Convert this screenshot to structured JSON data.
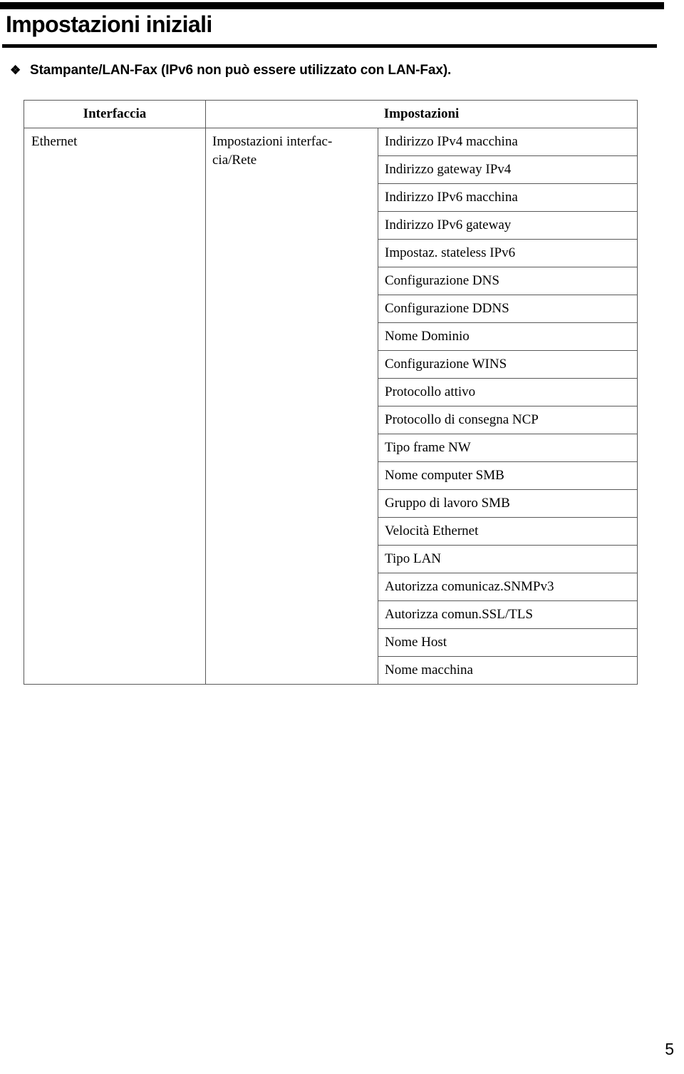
{
  "page": {
    "chapter_title": "Impostazioni iniziali",
    "folio": "5"
  },
  "caption": {
    "bullet_icon": "diamond-bullet-icon",
    "bullet_glyph": "❖",
    "text": "Stampante/LAN-Fax (IPv6 non può essere utilizzato con LAN-Fax)."
  },
  "table": {
    "headers": {
      "interface": "Interfaccia",
      "settings": "Impostazioni"
    },
    "rows": [
      {
        "interface": "Ethernet",
        "group": "Impostazioni interfac-­cia/Rete",
        "group_line1": "Impostazioni interfac-",
        "group_line2": "cia/Rete",
        "details": [
          "Indirizzo IPv4 macchina",
          "Indirizzo gateway IPv4",
          "Indirizzo IPv6 macchina",
          "Indirizzo IPv6 gateway",
          "Impostaz. stateless IPv6",
          "Configurazione DNS",
          "Configurazione DDNS",
          "Nome Dominio",
          "Configurazione WINS",
          "Protocollo attivo",
          "Protocollo di consegna NCP",
          "Tipo frame NW",
          "Nome computer SMB",
          "Gruppo di lavoro SMB",
          "Velocità Ethernet",
          "Tipo LAN",
          "Autorizza comunicaz.SNMPv3",
          "Autorizza comun.SSL/TLS",
          "Nome Host",
          "Nome macchina"
        ]
      }
    ]
  },
  "colors": {
    "text": "#000000",
    "rule": "#000000",
    "table_border": "#595959",
    "background": "#ffffff"
  }
}
